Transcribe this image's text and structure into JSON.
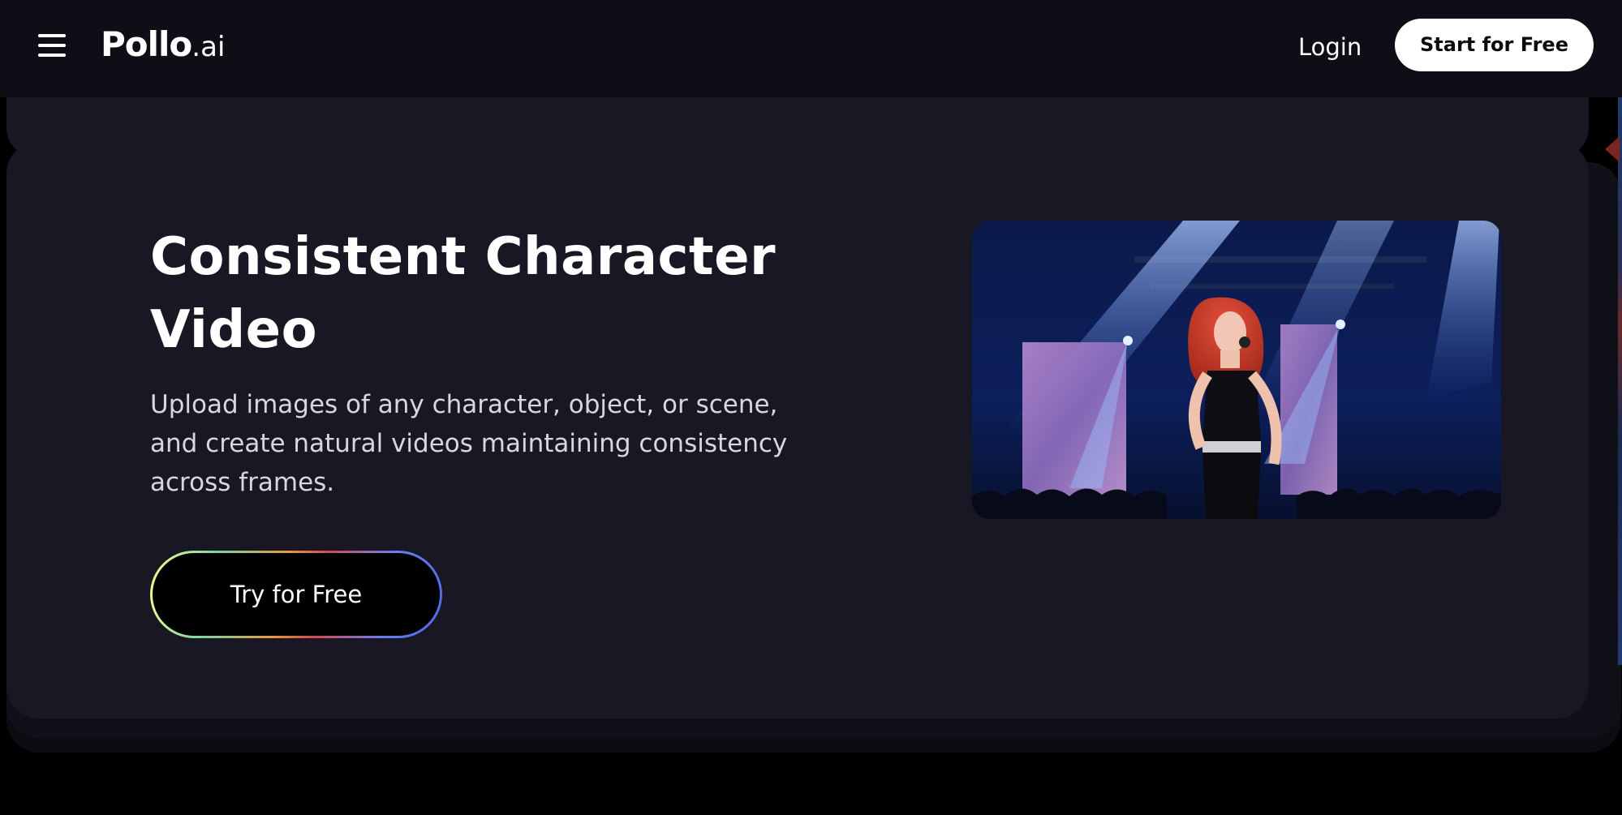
{
  "header": {
    "logo_main": "Pollo",
    "logo_suffix": ".ai",
    "login_label": "Login",
    "start_label": "Start for Free"
  },
  "hero": {
    "title": "Consistent Character Video",
    "description": "Upload images of any character, object, or scene, and create natural videos maintaining consistency across frames.",
    "cta_label": "Try for Free"
  },
  "colors": {
    "header_bg": "#0f0e16",
    "card_bg": "#181723",
    "page_bg": "#000000",
    "primary_button_bg": "#ffffff"
  },
  "icons": {
    "menu": "hamburger-menu-icon"
  }
}
